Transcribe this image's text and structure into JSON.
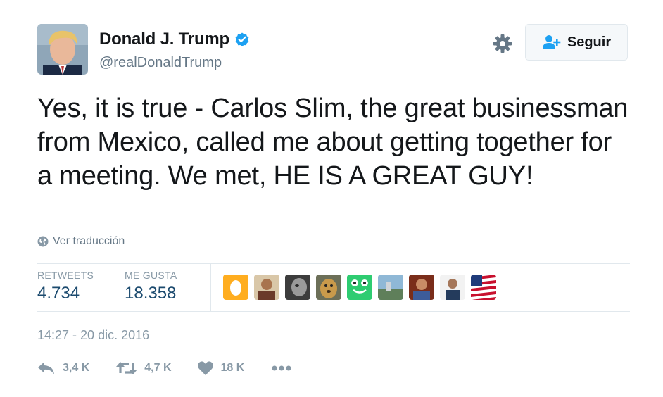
{
  "user": {
    "display_name": "Donald J. Trump",
    "handle": "@realDonaldTrump",
    "verified": true
  },
  "header": {
    "follow_label": "Seguir"
  },
  "tweet": {
    "text": "Yes, it is true - Carlos Slim, the great businessman from Mexico, called me about getting together for a meeting. We met, HE IS A GREAT GUY!",
    "translate_label": "Ver traducción",
    "timestamp": "14:27 - 20 dic. 2016"
  },
  "stats": {
    "retweets_label": "RETWEETS",
    "retweets_value": "4.734",
    "likes_label": "ME GUSTA",
    "likes_value": "18.358"
  },
  "likers": [
    {
      "name": "egg-avatar"
    },
    {
      "name": "man-avatar"
    },
    {
      "name": "grayscale-face-avatar"
    },
    {
      "name": "dog-avatar"
    },
    {
      "name": "frog-logo-avatar"
    },
    {
      "name": "landscape-avatar"
    },
    {
      "name": "person-avatar"
    },
    {
      "name": "suited-man-avatar"
    },
    {
      "name": "us-flag-avatar"
    }
  ],
  "actions": {
    "reply_count": "3,4 K",
    "retweet_count": "4,7 K",
    "like_count": "18 K"
  },
  "colors": {
    "text": "#14171a",
    "secondary": "#657786",
    "muted": "#8899a6",
    "stat_value": "#1b4a6e",
    "verified": "#1da1f2",
    "follow_icon": "#1da1f2"
  }
}
